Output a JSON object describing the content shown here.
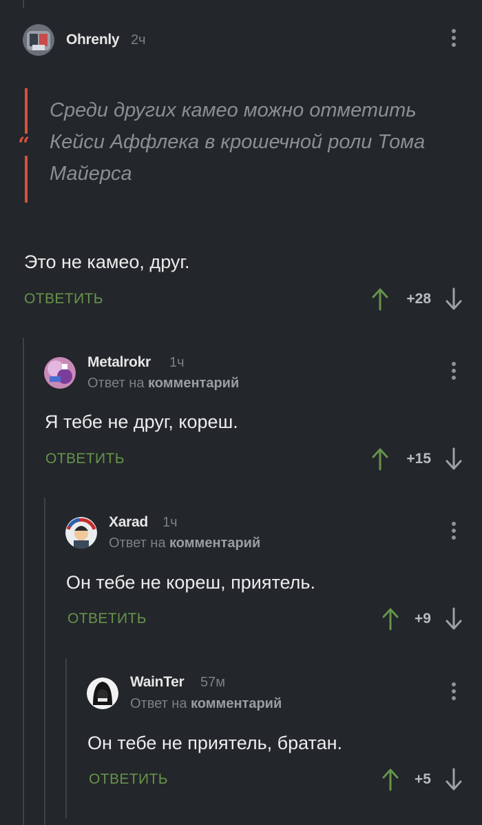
{
  "comments": [
    {
      "author": "Ohrenly",
      "time": "2ч",
      "quote": [
        "Среди других камео можно отметить",
        "Кейси Аффлека в крошечной роли Тома",
        "Майерса"
      ],
      "text": "Это не камео, друг.",
      "reply_label": "ОТВЕТИТЬ",
      "score": "+28"
    },
    {
      "author": "Metalrokr",
      "time": "1ч",
      "reply_prefix": "Ответ на",
      "reply_target": "комментарий",
      "text": "Я тебе не друг, кореш.",
      "reply_label": "ОТВЕТИТЬ",
      "score": "+15"
    },
    {
      "author": "Xarad",
      "time": "1ч",
      "reply_prefix": "Ответ на",
      "reply_target": "комментарий",
      "text": "Он тебе не кореш, приятель.",
      "reply_label": "ОТВЕТИТЬ",
      "score": "+9"
    },
    {
      "author": "WainTer",
      "time": "57м",
      "reply_prefix": "Ответ на",
      "reply_target": "комментарий",
      "text": "Он тебе не приятель, братан.",
      "reply_label": "ОТВЕТИТЬ",
      "score": "+5"
    }
  ],
  "colors": {
    "background": "#23262a",
    "reply_green": "#66944a",
    "quote_accent": "#d4533e",
    "muted": "#7d8186"
  },
  "icons": [
    "menu-dots-icon",
    "arrow-up-icon",
    "arrow-down-icon",
    "quote-icon"
  ]
}
